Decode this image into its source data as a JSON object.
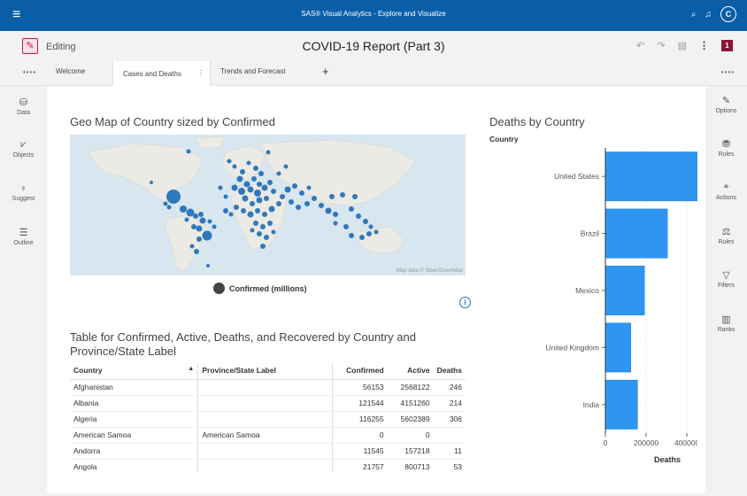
{
  "app": {
    "title": "SAS® Visual Analytics - Explore and Visualize",
    "avatar_initial": "C"
  },
  "header": {
    "mode": "Editing",
    "report_title": "COVID-19 Report (Part 3)",
    "page_number": "1"
  },
  "tabs": [
    "Welcome",
    "Cases and Deaths",
    "Trends and Forecast"
  ],
  "left_panel": [
    "Data",
    "Objects",
    "Suggest",
    "Outline"
  ],
  "right_panel": [
    "Options",
    "Roles",
    "Actions",
    "Rules",
    "Filters",
    "Ranks"
  ],
  "geo_map": {
    "title": "Geo Map of Country sized by Confirmed",
    "credit": "Map data © OpenStreetMap",
    "legend": "Confirmed (millions)"
  },
  "table": {
    "title": "Table for Confirmed, Active, Deaths, and Recovered by Country and Province/State Label",
    "headers": [
      "Country",
      "Province/State Label",
      "Confirmed",
      "Active",
      "Deaths"
    ],
    "rows": [
      [
        "Afghanistan",
        "",
        "56153",
        "2568122",
        "246"
      ],
      [
        "Albania",
        "",
        "121544",
        "4151260",
        "214"
      ],
      [
        "Algeria",
        "",
        "116255",
        "5602389",
        "306"
      ],
      [
        "American Samoa",
        "American Samoa",
        "0",
        "0",
        ""
      ],
      [
        "Andorra",
        "",
        "11545",
        "157218",
        "11"
      ],
      [
        "Angola",
        "",
        "21757",
        "800713",
        "53"
      ]
    ]
  },
  "chart_data": {
    "type": "bar",
    "orientation": "horizontal",
    "title": "Deaths by Country",
    "category_label": "Country",
    "xlabel": "Deaths",
    "categories": [
      "United States",
      "Brazil",
      "Mexico",
      "United Kingdom",
      "India"
    ],
    "values": [
      535000,
      305000,
      192000,
      125000,
      158000
    ],
    "xlim": [
      0,
      600000
    ],
    "ticks": [
      0,
      200000,
      400000
    ],
    "color": "#2e96f0",
    "grid": true
  }
}
